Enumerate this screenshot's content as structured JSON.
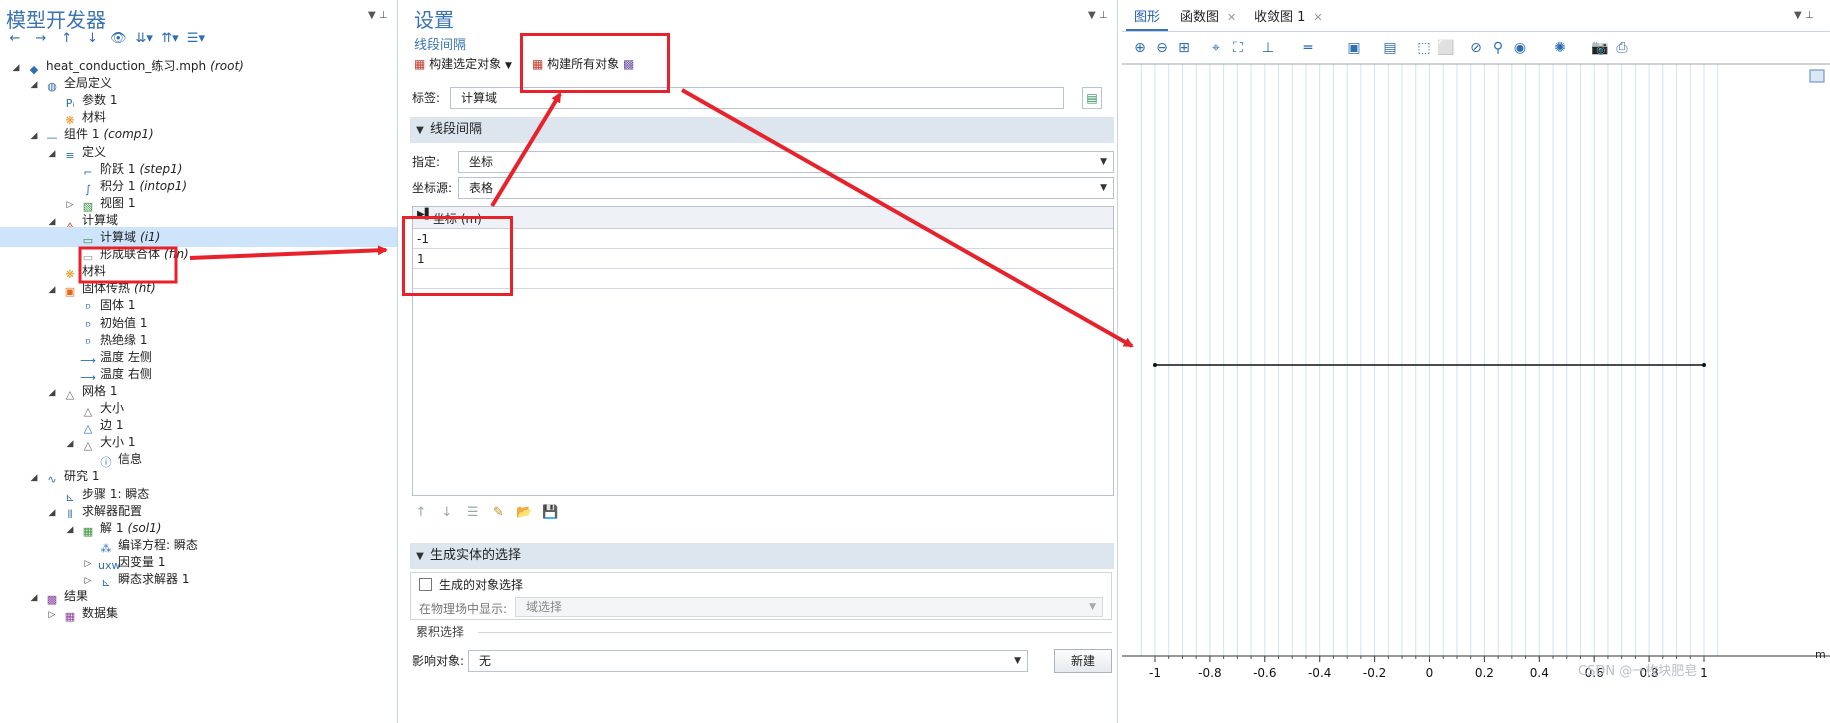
{
  "left": {
    "title": "模型开发器",
    "tree": [
      {
        "label": "heat_conduction_练习.mph",
        "tag": "(root)",
        "icon": "model-icon"
      },
      {
        "label": "全局定义",
        "tag": "",
        "icon": "globe-icon"
      },
      {
        "label": "参数 1",
        "tag": "",
        "icon": "parameters-icon"
      },
      {
        "label": "材料",
        "tag": "",
        "icon": "materials-icon"
      },
      {
        "label": "组件 1",
        "tag": "(comp1)",
        "icon": "component-icon"
      },
      {
        "label": "定义",
        "tag": "",
        "icon": "definitions-icon"
      },
      {
        "label": "阶跃 1",
        "tag": "(step1)",
        "icon": "step-icon"
      },
      {
        "label": "积分 1",
        "tag": "(intop1)",
        "icon": "integration-icon"
      },
      {
        "label": "视图 1",
        "tag": "",
        "icon": "view-icon"
      },
      {
        "label": "计算域",
        "tag": "",
        "icon": "geometry-icon"
      },
      {
        "label": "计算域",
        "tag": "(i1)",
        "icon": "interval-icon"
      },
      {
        "label": "形成联合体",
        "tag": "(fin)",
        "icon": "union-icon"
      },
      {
        "label": "材料",
        "tag": "",
        "icon": "materials-icon"
      },
      {
        "label": "固体传热",
        "tag": "(ht)",
        "icon": "heat-transfer-icon"
      },
      {
        "label": "固体 1",
        "tag": "",
        "icon": "solid-icon"
      },
      {
        "label": "初始值 1",
        "tag": "",
        "icon": "initial-values-icon"
      },
      {
        "label": "热绝缘 1",
        "tag": "",
        "icon": "insulation-icon"
      },
      {
        "label": "温度 左侧",
        "tag": "",
        "icon": "temperature-icon"
      },
      {
        "label": "温度 右侧",
        "tag": "",
        "icon": "temperature-icon"
      },
      {
        "label": "网格 1",
        "tag": "",
        "icon": "mesh-icon"
      },
      {
        "label": "大小",
        "tag": "",
        "icon": "size-icon"
      },
      {
        "label": "边 1",
        "tag": "",
        "icon": "edge-icon"
      },
      {
        "label": "大小 1",
        "tag": "",
        "icon": "size-icon"
      },
      {
        "label": "信息",
        "tag": "",
        "icon": "info-icon"
      },
      {
        "label": "研究 1",
        "tag": "",
        "icon": "study-icon"
      },
      {
        "label": "步骤 1: 瞬态",
        "tag": "",
        "icon": "time-dependent-icon"
      },
      {
        "label": "求解器配置",
        "tag": "",
        "icon": "solver-config-icon"
      },
      {
        "label": "解 1",
        "tag": "(sol1)",
        "icon": "solution-icon"
      },
      {
        "label": "编译方程: 瞬态",
        "tag": "",
        "icon": "compile-icon"
      },
      {
        "label": "因变量 1",
        "tag": "",
        "icon": "dependent-vars-icon"
      },
      {
        "label": "瞬态求解器 1",
        "tag": "",
        "icon": "time-solver-icon"
      },
      {
        "label": "结果",
        "tag": "",
        "icon": "results-icon"
      },
      {
        "label": "数据集",
        "tag": "",
        "icon": "datasets-icon"
      }
    ]
  },
  "mid": {
    "title": "设置",
    "subtitle": "线段间隔",
    "build_selected": "构建选定对象",
    "build_all": "构建所有对象",
    "label_caption": "标签:",
    "label_value": "计算域",
    "section1": "线段间隔",
    "specify_caption": "指定:",
    "specify_value": "坐标",
    "coord_source_caption": "坐标源:",
    "coord_source_value": "表格",
    "table_header": "坐标 (m)",
    "table_rows": [
      "-1",
      "1"
    ],
    "section2": "生成实体的选择",
    "gen_selection_label": "生成的对象选择",
    "show_in_physics_caption": "在物理场中显示:",
    "show_in_physics_value": "域选择",
    "cumulative_caption": "累积选择",
    "affected_caption": "影响对象:",
    "affected_value": "无",
    "new_button": "新建"
  },
  "right": {
    "tabs": [
      "图形",
      "函数图",
      "收敛图 1"
    ],
    "axis_unit": "m",
    "x_ticks": [
      "-1",
      "-0.8",
      "-0.6",
      "-0.4",
      "-0.2",
      "0",
      "0.2",
      "0.4",
      "0.6",
      "0.8",
      "1"
    ],
    "watermark": "CSDN @一枚块肥皂"
  },
  "chart_data": {
    "type": "line",
    "x": [
      -1,
      1
    ],
    "y": [
      0,
      0
    ],
    "xlim": [
      -1.05,
      1.05
    ],
    "xlabel": "m",
    "grid": true
  },
  "colors": {
    "accent": "#3a73b5",
    "annotation": "#e8222b",
    "selection": "#cde4fb",
    "section": "#dde6ef"
  }
}
